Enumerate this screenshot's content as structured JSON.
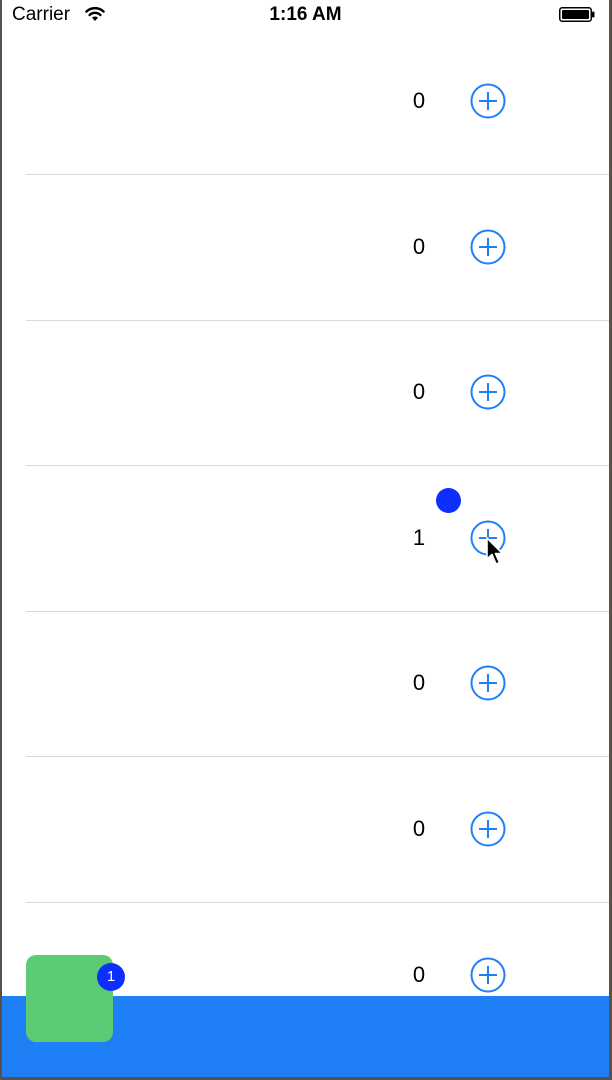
{
  "status_bar": {
    "carrier": "Carrier",
    "time": "1:16 AM",
    "wifi_icon": "wifi-icon",
    "battery_icon": "battery-icon"
  },
  "rows": [
    {
      "count": "0",
      "button_icon": "plus-circle-icon"
    },
    {
      "count": "0",
      "button_icon": "plus-circle-icon"
    },
    {
      "count": "0",
      "button_icon": "plus-circle-icon"
    },
    {
      "count": "1",
      "button_icon": "plus-circle-icon"
    },
    {
      "count": "0",
      "button_icon": "plus-circle-icon"
    },
    {
      "count": "0",
      "button_icon": "plus-circle-icon"
    },
    {
      "count": "0",
      "button_icon": "plus-circle-icon"
    }
  ],
  "cart": {
    "badge_count": "1"
  },
  "colors": {
    "accent": "#1f7ff7",
    "cart": "#5dca74",
    "badge": "#0c2fff",
    "separator": "#d9d9d9"
  }
}
